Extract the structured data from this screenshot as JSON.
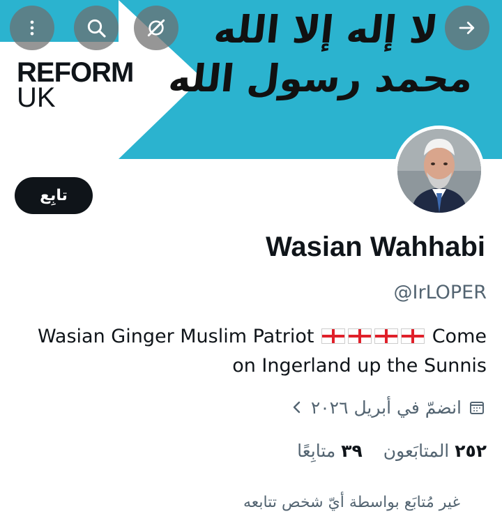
{
  "banner": {
    "logo_line1": "REFORM",
    "logo_line2": "UK",
    "calligraphy_line1": "لا إله إلا الله",
    "calligraphy_line2": "محمد رسول الله",
    "banner_color": "#2bb3cf"
  },
  "topbar": {
    "more_icon": "more-vertical-icon",
    "search_icon": "search-icon",
    "grok_icon": "grok-icon",
    "forward_icon": "arrow-right-icon"
  },
  "profile": {
    "follow_label": "تابِع",
    "display_name": "Wasian Wahhabi",
    "handle": "@IrLOPER",
    "bio_part1": "Wasian Ginger Muslim Patriot",
    "bio_part2": "Come on Ingerland up the Sunnis",
    "joined": "انضمّ في أبريل ٢٠٢٦",
    "followers_count": "٢٥٢",
    "followers_label": "المتابَعون",
    "following_count": "٣٩",
    "following_label": "متابِعًا",
    "not_followed_text": "غير مُتابَع بواسطة أيّ شخص تتابعه"
  }
}
